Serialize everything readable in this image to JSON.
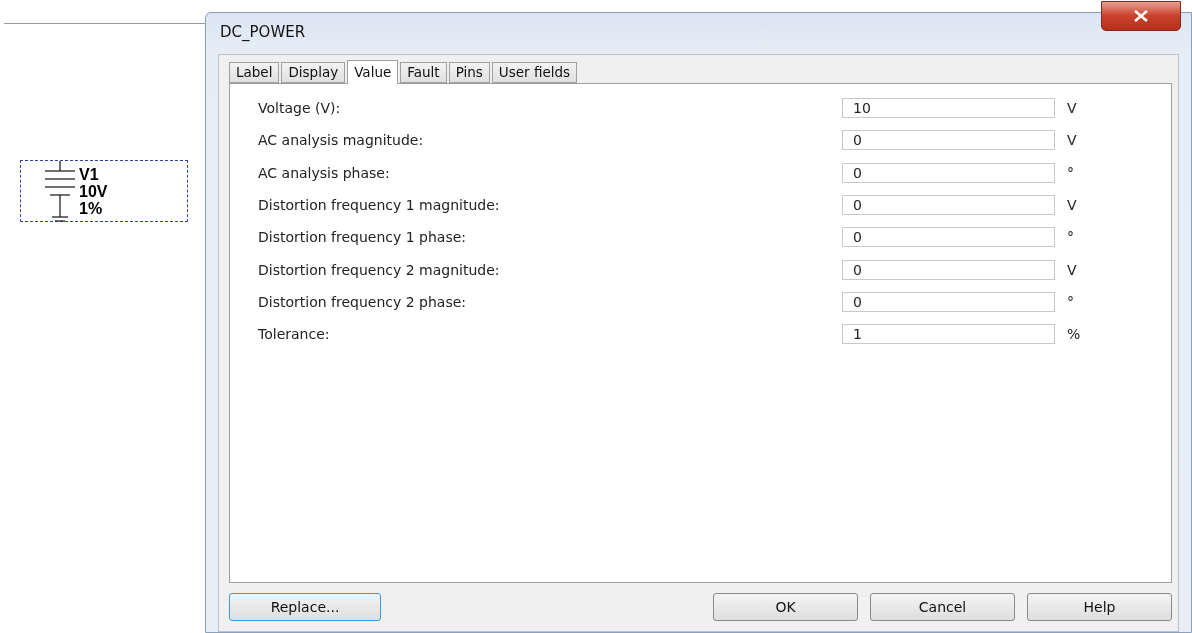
{
  "schematic": {
    "component_labels": [
      "V1",
      "10V",
      "1%"
    ]
  },
  "window": {
    "title": "DC_POWER"
  },
  "tabs": [
    {
      "label": "Label",
      "selected": false
    },
    {
      "label": "Display",
      "selected": false
    },
    {
      "label": "Value",
      "selected": true
    },
    {
      "label": "Fault",
      "selected": false
    },
    {
      "label": "Pins",
      "selected": false
    },
    {
      "label": "User fields",
      "selected": false
    }
  ],
  "fields": [
    {
      "label": "Voltage (V):",
      "value": "10",
      "unit": "V"
    },
    {
      "label": "AC analysis magnitude:",
      "value": "0",
      "unit": "V"
    },
    {
      "label": "AC analysis phase:",
      "value": "0",
      "unit": "°"
    },
    {
      "label": "Distortion frequency 1 magnitude:",
      "value": "0",
      "unit": "V"
    },
    {
      "label": "Distortion frequency 1 phase:",
      "value": "0",
      "unit": "°"
    },
    {
      "label": "Distortion frequency 2 magnitude:",
      "value": "0",
      "unit": "V"
    },
    {
      "label": "Distortion frequency 2 phase:",
      "value": "0",
      "unit": "°"
    },
    {
      "label": "Tolerance:",
      "value": "1",
      "unit": "%"
    }
  ],
  "buttons": {
    "left": "Replace...",
    "right": [
      "OK",
      "Cancel",
      "Help"
    ]
  }
}
